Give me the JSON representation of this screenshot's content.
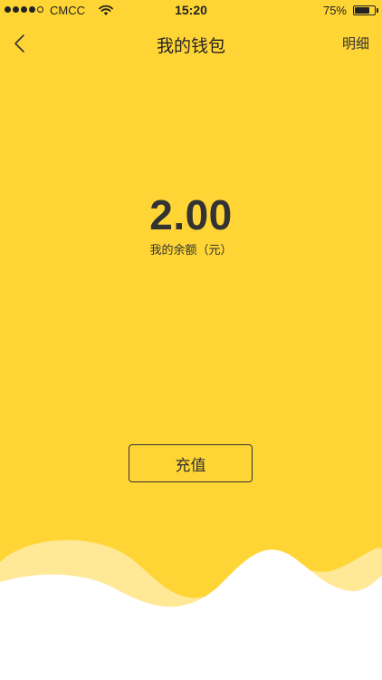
{
  "status_bar": {
    "signal_filled_dots": 4,
    "signal_total_dots": 5,
    "carrier": "CMCC",
    "wifi_icon": "wifi-icon",
    "time": "15:20",
    "battery_percent": "75%",
    "battery_level": 0.75
  },
  "nav": {
    "back_icon": "chevron-left-icon",
    "title": "我的钱包",
    "detail_label": "明细"
  },
  "wallet": {
    "balance": "2.00",
    "balance_label": "我的余额（元）",
    "recharge_label": "充值"
  },
  "colors": {
    "background": "#ffd535",
    "wave_light": "#ffe896",
    "wave_white": "#ffffff",
    "text": "#333333"
  }
}
